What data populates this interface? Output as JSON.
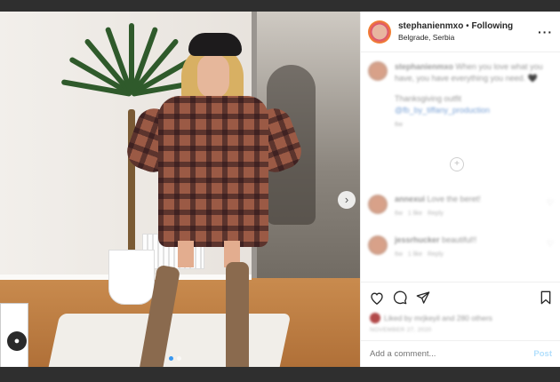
{
  "post": {
    "username": "stephanienmxo",
    "separator": "•",
    "follow_label": "Following",
    "location": "Belgrade, Serbia",
    "more_label": "···"
  },
  "caption": {
    "username": "stephanienmxo",
    "text": "When you love what you have, you have everything you need. 🖤",
    "line2": "Thanksgiving outfit",
    "tag": "@fb_by_tiffany_production",
    "time": "6w"
  },
  "comments": [
    {
      "username": "annexui",
      "text": "Love the beret!",
      "time": "6w",
      "likes": "1 like",
      "reply": "Reply"
    },
    {
      "username": "jessrhucker",
      "text": "beautiful!!",
      "time": "6w",
      "likes": "1 like",
      "reply": "Reply"
    }
  ],
  "likes_text": "Liked by mrjkeyil and 280 others",
  "date_text": "NOVEMBER 27, 2020",
  "add_comment": {
    "placeholder": "Add a comment...",
    "post_label": "Post"
  },
  "colors": {
    "link": "#3897f0",
    "post_disabled": "#b2dffc"
  }
}
